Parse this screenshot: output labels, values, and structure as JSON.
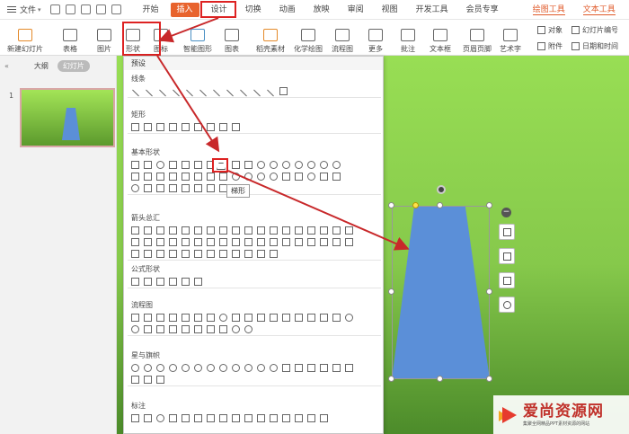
{
  "menu": {
    "file": "文件",
    "tabs": [
      "开始",
      "插入",
      "设计",
      "切换",
      "动画",
      "放映",
      "审阅",
      "视图",
      "开发工具",
      "会员专享"
    ],
    "active_tab": "插入",
    "right_tabs": [
      "绘图工具",
      "文本工具"
    ]
  },
  "toolbar": {
    "new_slide": "新建幻灯片",
    "table": "表格",
    "image": "图片",
    "shape": "形状",
    "icon": "图标",
    "smart": "智能图形",
    "chart": "图表",
    "material": "稻壳素材",
    "chem": "化学绘图",
    "flow": "流程图",
    "more": "更多",
    "comment": "批注",
    "textbox": "文本框",
    "header": "页眉页脚",
    "art": "艺术字",
    "object": "对象",
    "slide_num": "幻灯片编号",
    "attach": "附件",
    "datetime": "日期和时间"
  },
  "left_panel": {
    "outline": "大纲",
    "slides": "幻灯片",
    "slide_number": "1"
  },
  "dropdown": {
    "preset": "预设",
    "sections": [
      "线条",
      "矩形",
      "基本形状",
      "箭头总汇",
      "公式形状",
      "流程图",
      "星与旗帜",
      "标注"
    ],
    "tooltip": "梯形"
  },
  "watermark": {
    "title": "爱尚资源网",
    "subtitle": "集聚全网精品PPT素材资源的网站"
  },
  "colors": {
    "accent": "#e8632d",
    "shape_fill": "#5b8fd8",
    "highlight": "#dd2222"
  }
}
